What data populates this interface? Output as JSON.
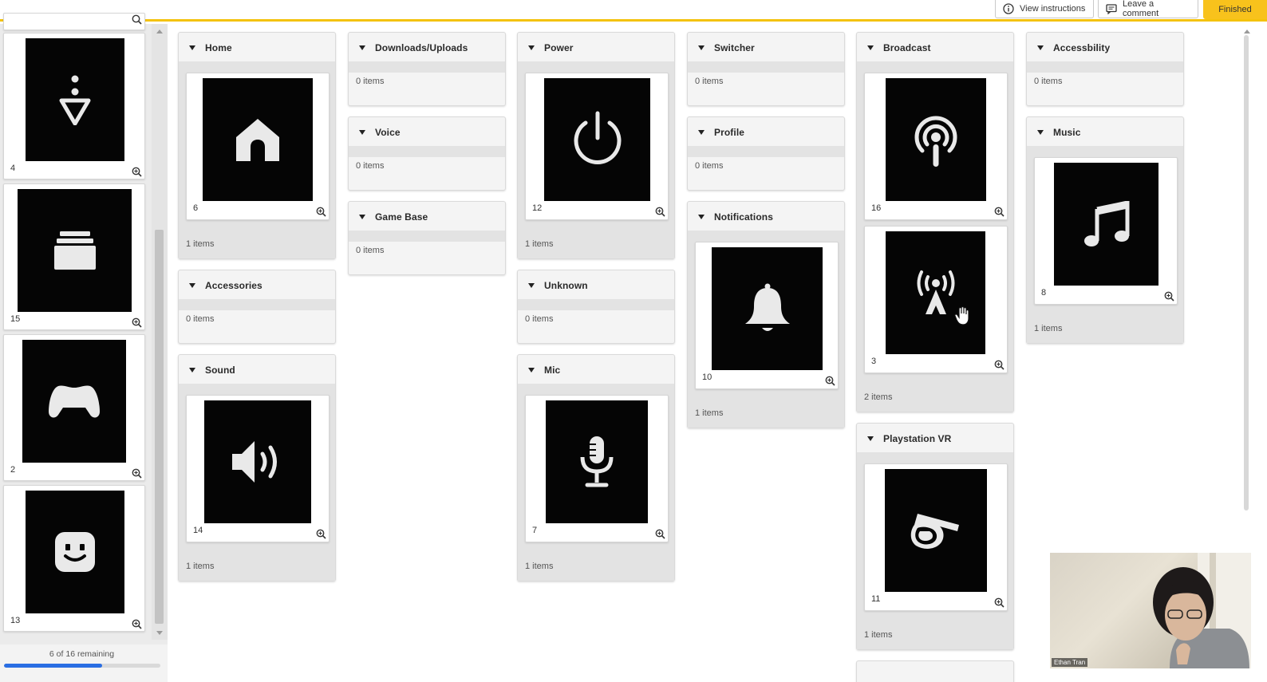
{
  "toolbar": {
    "view_instructions": "View instructions",
    "leave_comment": "Leave a comment",
    "finished": "Finished"
  },
  "sidebar": {
    "cards": [
      {
        "number": "4",
        "icon": "pin-triangle-icon"
      },
      {
        "number": "15",
        "icon": "stack-icon"
      },
      {
        "number": "2",
        "icon": "gamepad-icon"
      },
      {
        "number": "13",
        "icon": "robot-face-icon"
      }
    ],
    "remaining": "6 of 16 remaining",
    "progress": 0.625
  },
  "categories": {
    "home": {
      "title": "Home",
      "count": "1 items",
      "cards": [
        {
          "number": "6",
          "icon": "home-icon"
        }
      ]
    },
    "accessories": {
      "title": "Accessories",
      "count": "0 items"
    },
    "sound": {
      "title": "Sound",
      "count": "1 items",
      "cards": [
        {
          "number": "14",
          "icon": "speaker-icon"
        }
      ]
    },
    "downloads": {
      "title": "Downloads/Uploads",
      "count": "0 items"
    },
    "voice": {
      "title": "Voice",
      "count": "0 items"
    },
    "game_base": {
      "title": "Game Base",
      "count": "0 items"
    },
    "power": {
      "title": "Power",
      "count": "1 items",
      "cards": [
        {
          "number": "12",
          "icon": "power-icon"
        }
      ]
    },
    "unknown": {
      "title": "Unknown",
      "count": "0 items"
    },
    "mic": {
      "title": "Mic",
      "count": "1 items",
      "cards": [
        {
          "number": "7",
          "icon": "microphone-icon"
        }
      ]
    },
    "switcher": {
      "title": "Switcher",
      "count": "0 items"
    },
    "profile": {
      "title": "Profile",
      "count": "0 items"
    },
    "notifications": {
      "title": "Notifications",
      "count": "1 items",
      "cards": [
        {
          "number": "10",
          "icon": "bell-icon"
        }
      ]
    },
    "broadcast": {
      "title": "Broadcast",
      "count": "2 items",
      "cards": [
        {
          "number": "16",
          "icon": "podcast-icon"
        },
        {
          "number": "3",
          "icon": "broadcast-tower-icon"
        }
      ]
    },
    "playstation_vr": {
      "title": "Playstation VR",
      "count": "1 items",
      "cards": [
        {
          "number": "11",
          "icon": "vr-headset-icon"
        }
      ]
    },
    "accessibility": {
      "title": "Accessbility",
      "count": "0 items"
    },
    "music": {
      "title": "Music",
      "count": "1 items",
      "cards": [
        {
          "number": "8",
          "icon": "music-note-icon"
        }
      ]
    }
  },
  "webcam": {
    "name": "Ethan Tran"
  },
  "colors": {
    "accent_bar": "#f4c20d",
    "finished_button": "#f8c21c",
    "progress": "#2a6ee3",
    "card_image": "#050505"
  }
}
